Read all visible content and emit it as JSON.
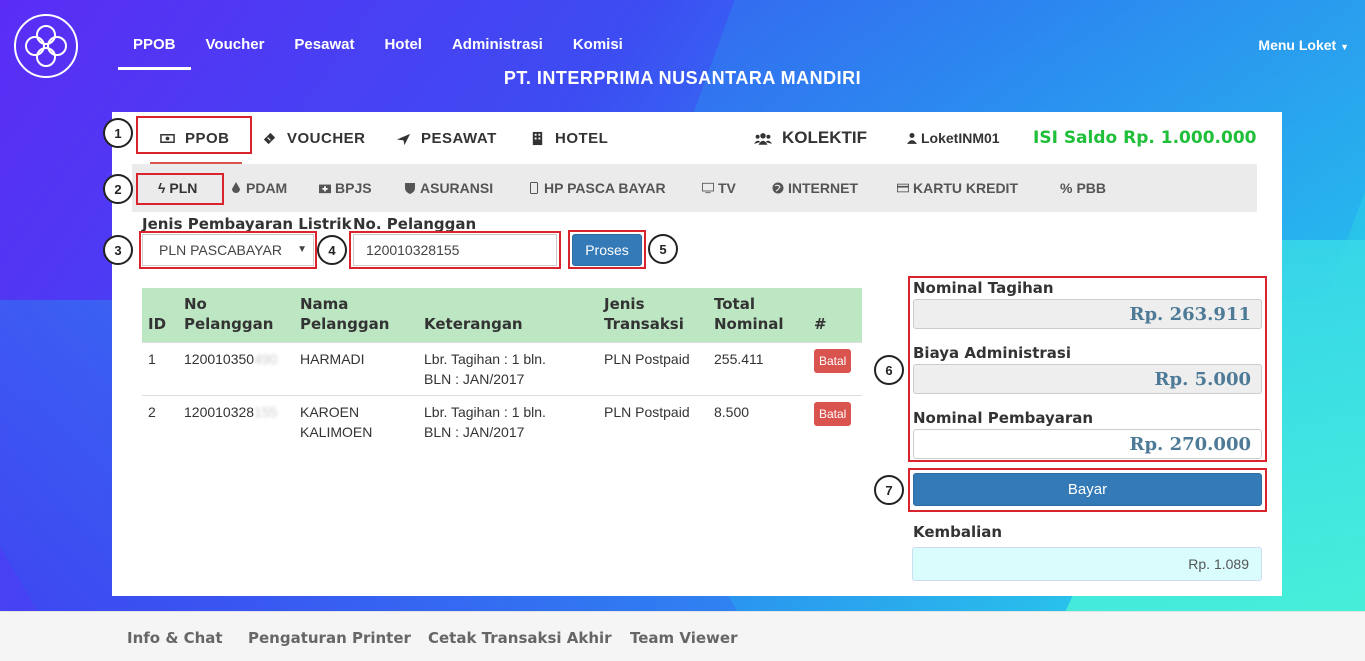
{
  "topnav": {
    "items": [
      "PPOB",
      "Voucher",
      "Pesawat",
      "Hotel",
      "Administrasi",
      "Komisi"
    ],
    "menu_loket": "Menu Loket",
    "company": "PT. INTERPRIMA NUSANTARA MANDIRI"
  },
  "product_tabs": {
    "ppob": "PPOB",
    "voucher": "VOUCHER",
    "pesawat": "PESAWAT",
    "hotel": "HOTEL",
    "kolektif": "KOLEKTIF",
    "user": "LoketINM01",
    "saldo": "ISI Saldo Rp. 1.000.000"
  },
  "sub_tabs": [
    "PLN",
    "PDAM",
    "BPJS",
    "ASURANSI",
    "HP PASCA BAYAR",
    "TV",
    "INTERNET",
    "KARTU KREDIT",
    "PBB"
  ],
  "form": {
    "jenis_label": "Jenis Pembayaran Listrik",
    "jenis_value": "PLN PASCABAYAR",
    "no_label": "No. Pelanggan",
    "no_value": "120010328155",
    "proses": "Proses"
  },
  "table": {
    "headers": [
      "ID",
      "No Pelanggan",
      "Nama Pelanggan",
      "Keterangan",
      "Jenis Transaksi",
      "Total Nominal",
      "#"
    ],
    "rows": [
      {
        "id": "1",
        "no": "120010350",
        "no_hidden": "490",
        "nama": "HARMADI",
        "ket1": "Lbr. Tagihan : 1 bln.",
        "ket2": "BLN : JAN/2017",
        "jenis": "PLN Postpaid",
        "total": "255.411",
        "action": "Batal"
      },
      {
        "id": "2",
        "no": "120010328",
        "no_hidden": "155",
        "nama": "KAROEN KALIMOEN",
        "ket1": "Lbr. Tagihan : 1 bln.",
        "ket2": "BLN : JAN/2017",
        "jenis": "PLN Postpaid",
        "total": "8.500",
        "action": "Batal"
      }
    ]
  },
  "summary": {
    "tagihan_label": "Nominal Tagihan",
    "tagihan_value": "Rp. 263.911",
    "admin_label": "Biaya Administrasi",
    "admin_value": "Rp. 5.000",
    "bayar_nominal_label": "Nominal Pembayaran",
    "bayar_nominal_value": "Rp. 270.000",
    "bayar_button": "Bayar",
    "kembalian_label": "Kembalian",
    "kembalian_value": "Rp. 1.089"
  },
  "callouts": [
    "1",
    "2",
    "3",
    "4",
    "5",
    "6",
    "7"
  ],
  "footer": [
    "Info & Chat",
    "Pengaturan Printer",
    "Cetak Transaksi Akhir",
    "Team Viewer"
  ],
  "colors": {
    "primary": "#337ab7",
    "danger": "#d9534f",
    "saldo": "#1fbf3a",
    "highlight": "#d9232d"
  }
}
